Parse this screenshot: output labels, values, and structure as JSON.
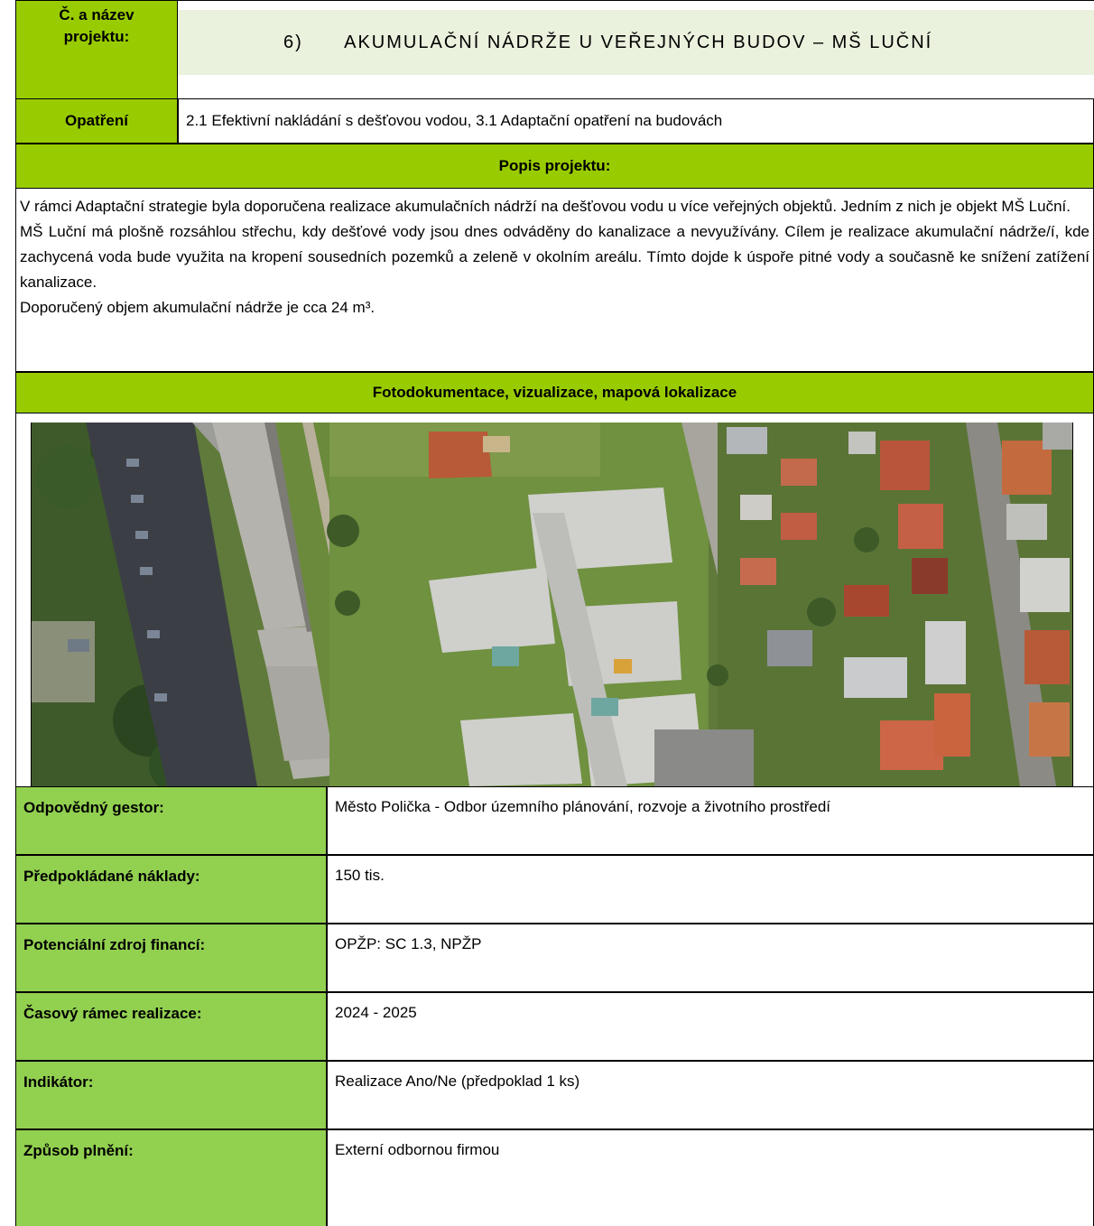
{
  "header": {
    "project_label_line1": "Č. a název",
    "project_label_line2": "projektu:",
    "project_title": "6)      AKUMULAČNÍ NÁDRŽE U VEŘEJNÝCH BUDOV – MŠ LUČNÍ"
  },
  "measure": {
    "label": "Opatření",
    "value": "2.1 Efektivní nakládání s dešťovou vodou, 3.1 Adaptační opatření na budovách"
  },
  "description": {
    "heading": "Popis projektu:",
    "paragraph1": "V rámci Adaptační strategie byla doporučena realizace akumulačních nádrží na dešťovou vodu u více veřejných objektů. Jedním z nich je objekt MŠ Luční.",
    "paragraph2": "MŠ Luční má plošně rozsáhlou střechu, kdy dešťové vody jsou dnes odváděny do kanalizace a nevyužívány. Cílem je realizace akumulační nádrže/í, kde zachycená voda bude využita na kropení sousedních pozemků a zeleně v okolním areálu. Tímto dojde k úspoře pitné vody a současně ke snížení zatížení kanalizace.",
    "paragraph3": "Doporučený objem akumulační nádrže je cca 24 m³."
  },
  "photo_section": {
    "heading": "Fotodokumentace, vizualizace, mapová lokalizace"
  },
  "details": [
    {
      "label": "Odpovědný gestor:",
      "value": "Město Polička - Odbor územního plánování, rozvoje a životního prostředí"
    },
    {
      "label": "Předpokládané náklady:",
      "value": "150 tis."
    },
    {
      "label": "Potenciální zdroj financí:",
      "value": "OPŽP: SC 1.3, NPŽP"
    },
    {
      "label": "Časový rámec realizace:",
      "value": "2024 - 2025"
    },
    {
      "label": "Indikátor:",
      "value": "Realizace Ano/Ne (předpoklad 1 ks)"
    },
    {
      "label": "Způsob plnění:",
      "value": "Externí odbornou firmou"
    }
  ]
}
